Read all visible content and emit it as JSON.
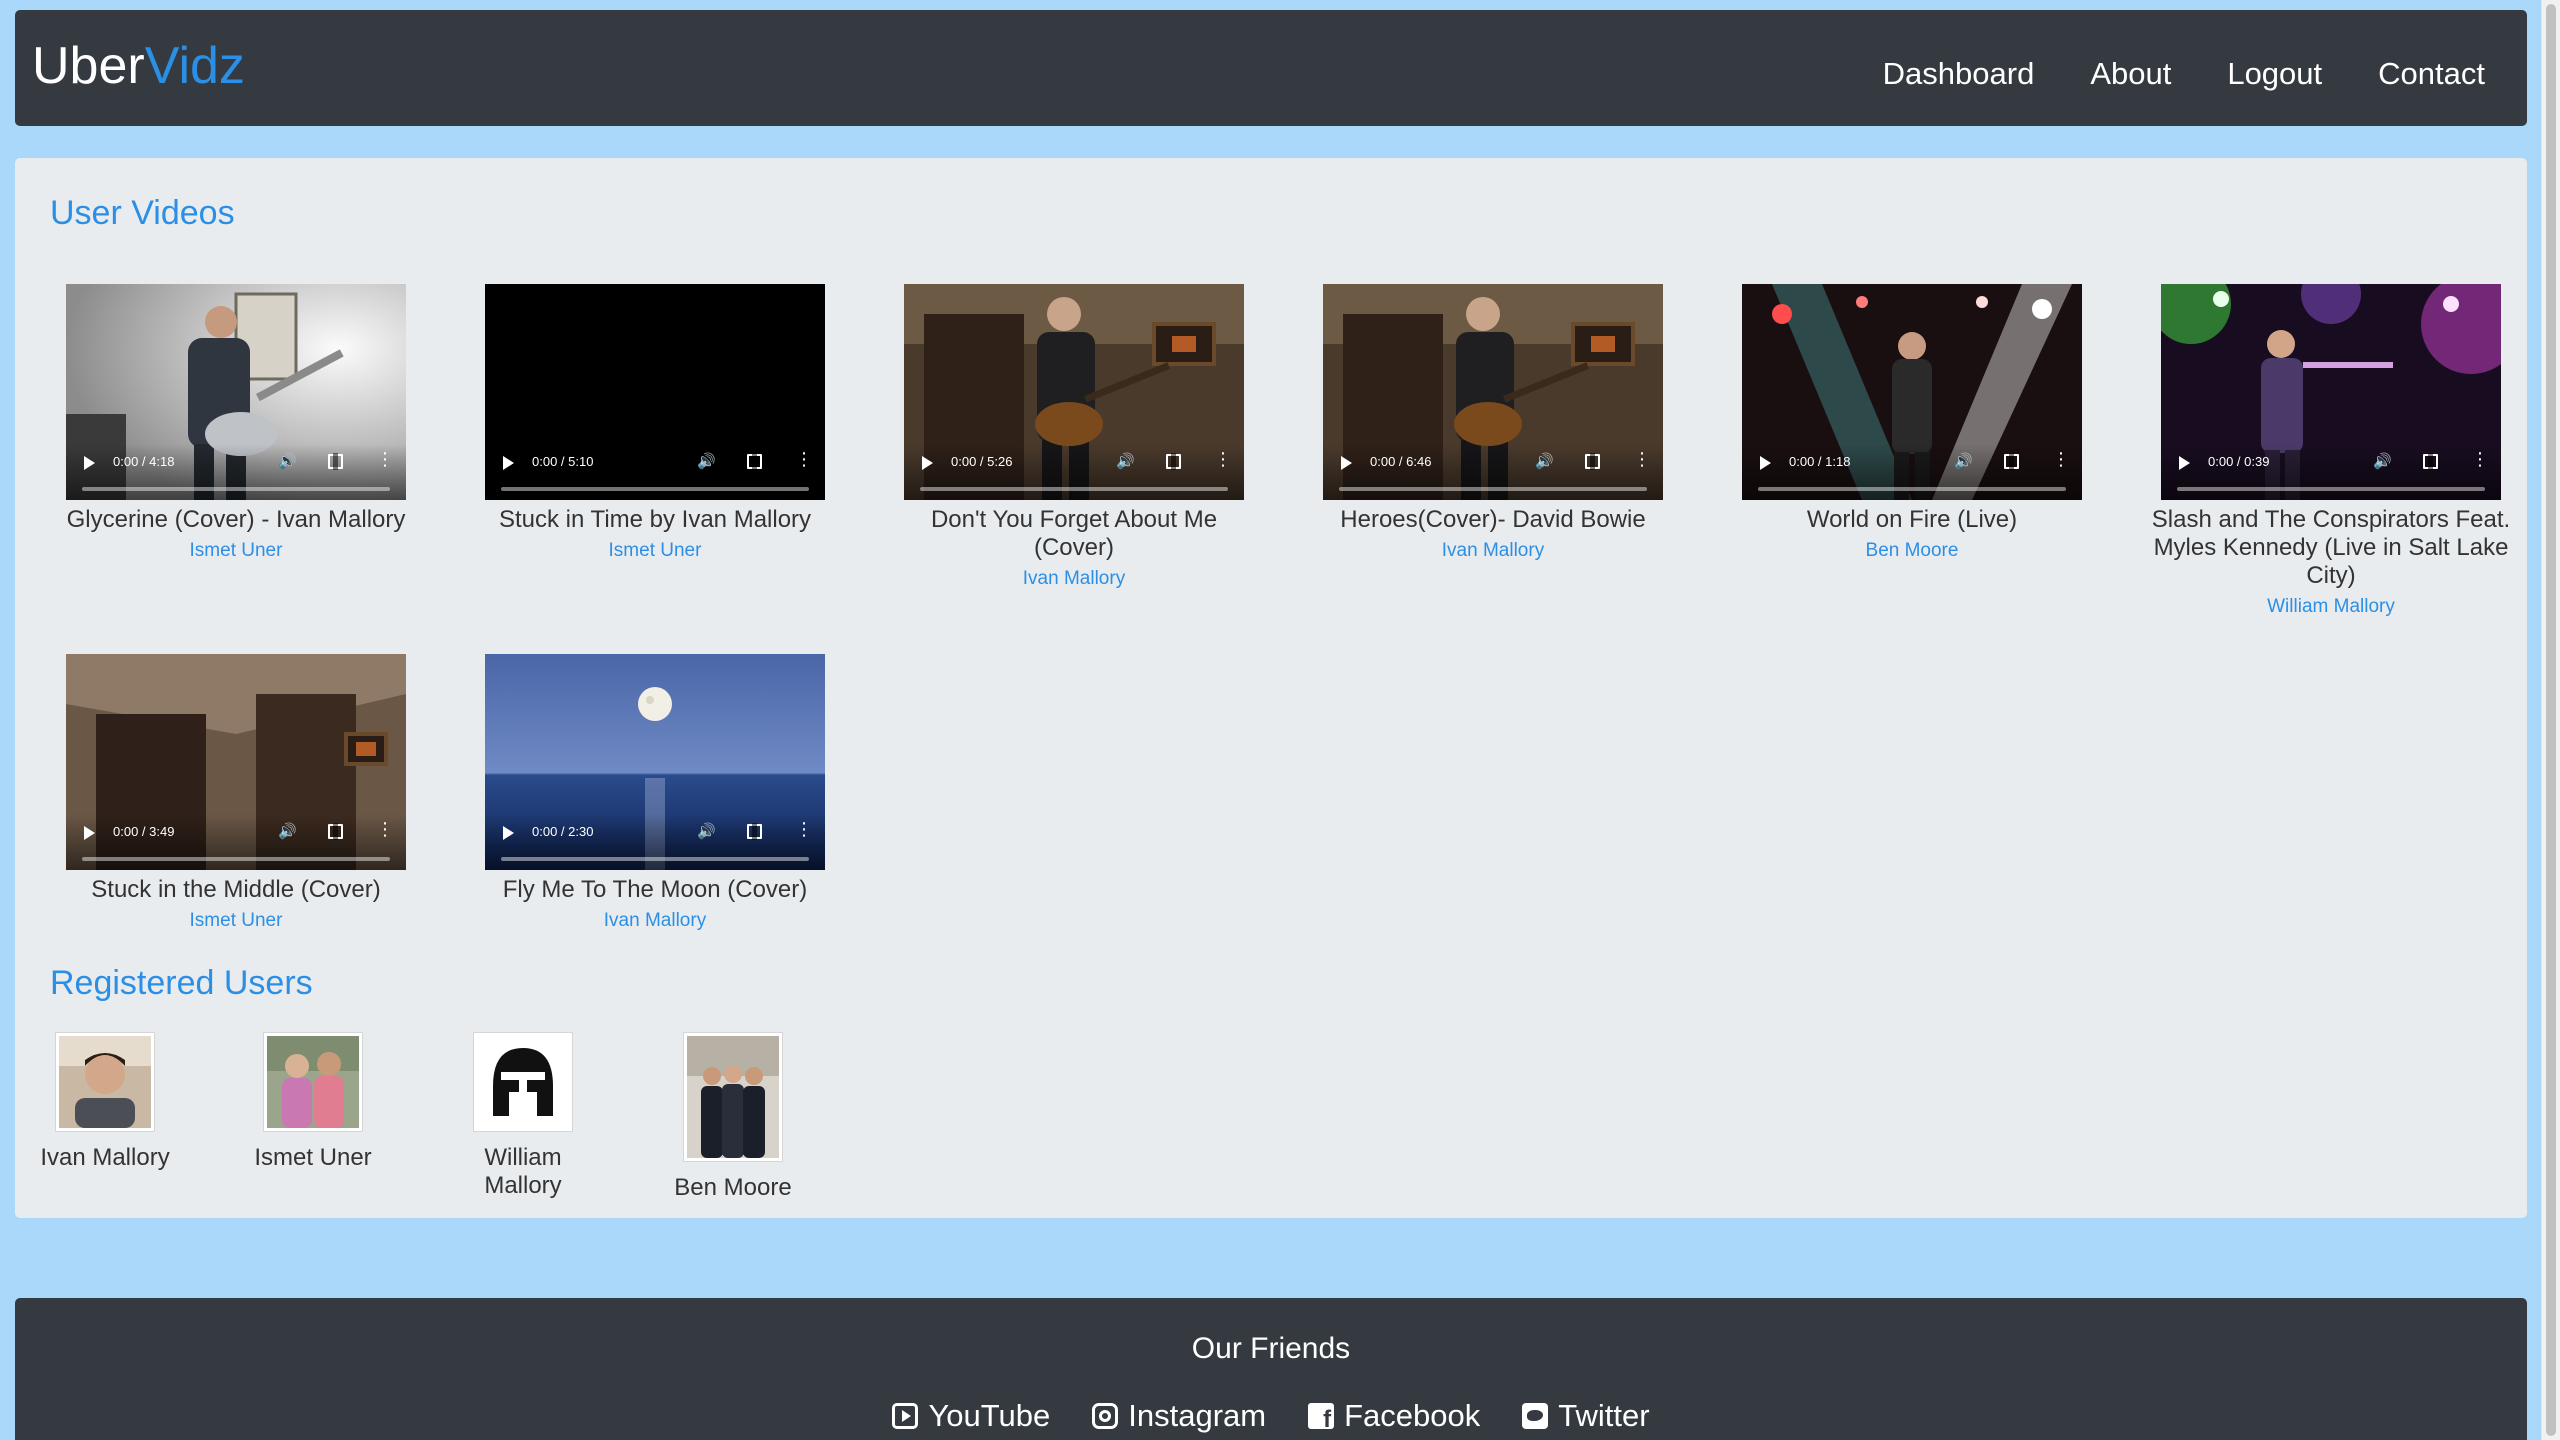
{
  "brand": {
    "part1": "Uber",
    "part2": "Vidz"
  },
  "nav": {
    "items": [
      "Dashboard",
      "About",
      "Logout",
      "Contact"
    ]
  },
  "videos_section": {
    "title": "User Videos",
    "videos": [
      {
        "title": "Glycerine (Cover) - Ivan Mallory",
        "author": "Ismet Uner",
        "time": "0:00 / 4:18",
        "thumb": "person-guitar-bright-room"
      },
      {
        "title": "Stuck in Time by Ivan Mallory",
        "author": "Ismet Uner",
        "time": "0:00 / 5:10",
        "thumb": "black"
      },
      {
        "title": "Don't You Forget About Me (Cover)",
        "author": "Ivan Mallory",
        "time": "0:00 / 5:26",
        "thumb": "person-guitar-brown-room"
      },
      {
        "title": "Heroes(Cover)- David Bowie",
        "author": "Ivan Mallory",
        "time": "0:00 / 6:46",
        "thumb": "person-guitar-brown-room"
      },
      {
        "title": "World on Fire (Live)",
        "author": "Ben Moore",
        "time": "0:00 / 1:18",
        "thumb": "concert-stage"
      },
      {
        "title": "Slash and The Conspirators Feat. Myles Kennedy (Live in Salt Lake City)",
        "author": "William Mallory",
        "time": "0:00 / 0:39",
        "thumb": "concert-stage-colored"
      },
      {
        "title": "Stuck in the Middle (Cover)",
        "author": "Ismet Uner",
        "time": "0:00 / 3:49",
        "thumb": "empty-brown-room"
      },
      {
        "title": "Fly Me To The Moon (Cover)",
        "author": "Ivan Mallory",
        "time": "0:00 / 2:30",
        "thumb": "moon-over-sea"
      }
    ]
  },
  "users_section": {
    "title": "Registered Users",
    "users": [
      {
        "name": "Ivan Mallory",
        "avatar": "portrait-photo"
      },
      {
        "name": "Ismet Uner",
        "avatar": "couple-photo"
      },
      {
        "name": "William Mallory",
        "avatar": "helmet-icon"
      },
      {
        "name": "Ben Moore",
        "avatar": "group-photo"
      }
    ]
  },
  "footer": {
    "title": "Our Friends",
    "links": [
      {
        "label": "YouTube",
        "icon": "youtube-icon"
      },
      {
        "label": "Instagram",
        "icon": "instagram-icon"
      },
      {
        "label": "Facebook",
        "icon": "facebook-icon"
      },
      {
        "label": "Twitter",
        "icon": "twitter-icon"
      }
    ]
  },
  "colors": {
    "accent": "#2b8fe6",
    "navbar": "#343a40",
    "page_bg": "#a9d8fb",
    "card_bg": "#e9ecef"
  }
}
